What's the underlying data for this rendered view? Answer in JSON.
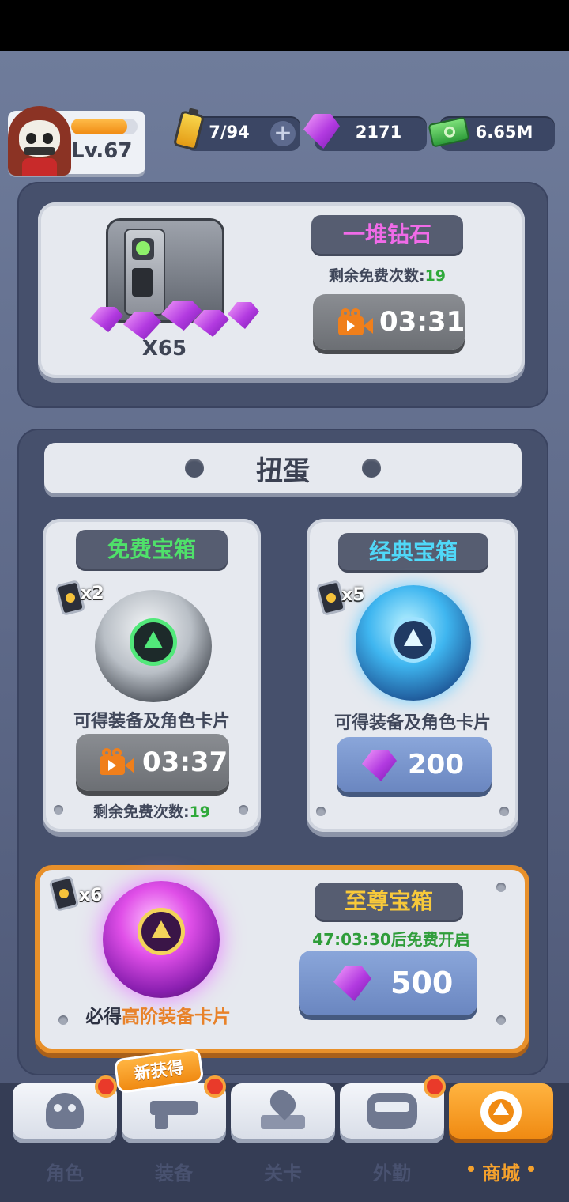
{
  "player": {
    "level": "Lv.67",
    "level_progress": 0.85
  },
  "resources": {
    "energy": "7/94",
    "gems": "2171",
    "cash": "6.65M"
  },
  "diamond_offer": {
    "title": "一堆钻石",
    "free_label": "剩余免费次数:",
    "free_count": "19",
    "quantity": "X65",
    "timer": "03:31"
  },
  "gacha": {
    "section_title": "扭蛋",
    "free_box": {
      "title": "免费宝箱",
      "multiplier": "x2",
      "desc": "可得装备及角色卡片",
      "timer": "03:37",
      "free_label": "剩余免费次数:",
      "free_count": "19"
    },
    "classic_box": {
      "title": "经典宝箱",
      "multiplier": "x5",
      "desc": "可得装备及角色卡片",
      "price": "200"
    },
    "supreme_box": {
      "title": "至尊宝箱",
      "multiplier": "x6",
      "countdown": "47:03:30后免费开启",
      "desc_prefix": "必得",
      "desc_highlight": "高阶装备卡片",
      "price": "500"
    }
  },
  "nav": {
    "new_badge": "新获得",
    "items": [
      {
        "label": "角色",
        "icon": "skull-icon"
      },
      {
        "label": "装备",
        "icon": "gun-icon"
      },
      {
        "label": "关卡",
        "icon": "map-pin-icon"
      },
      {
        "label": "外勤",
        "icon": "gamepad-icon"
      },
      {
        "label": "商城",
        "icon": "shop-icon"
      }
    ]
  },
  "colors": {
    "accent_orange": "#f5a12c",
    "gem_purple": "#b23ae0",
    "green": "#2fa93a"
  }
}
